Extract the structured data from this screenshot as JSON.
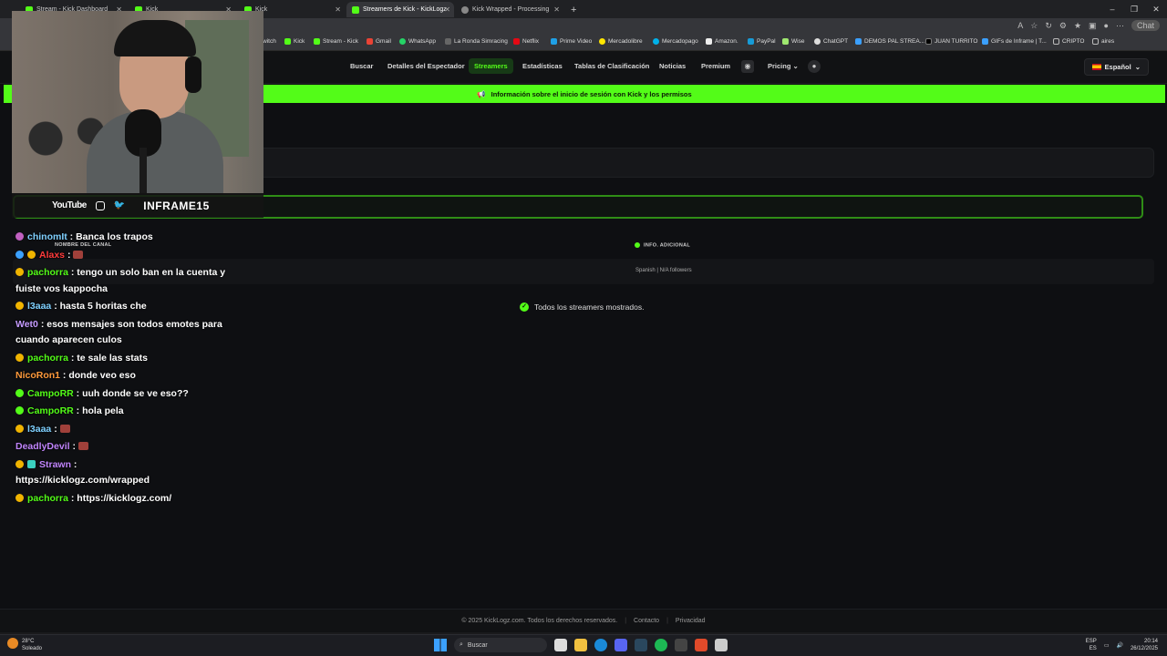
{
  "browser": {
    "tabs": [
      {
        "title": "Stream - Kick Dashboard",
        "active": false
      },
      {
        "title": "Kick",
        "active": false
      },
      {
        "title": "Kick",
        "active": false
      },
      {
        "title": "Streamers de Kick - KickLogz",
        "active": true
      },
      {
        "title": "Kick Wrapped - Processing",
        "active": false
      }
    ],
    "new_tab": "+",
    "chat_button": "Chat",
    "bookmarks": [
      "witch",
      "Kick",
      "Stream - Kick",
      "Gmail",
      "WhatsApp",
      "La Ronda Simracing",
      "Netflix",
      "Prime Video",
      "Mercadolibre",
      "Mercadopago",
      "Amazon.",
      "PayPal",
      "Wise",
      "ChatGPT",
      "DEMOS PAL STREA...",
      "JUAN TURRITO",
      "GIFs de Inframe | T...",
      "CRIPTO",
      "aires"
    ]
  },
  "nav": {
    "items": [
      "Buscar",
      "Detalles del Espectador",
      "Streamers",
      "Estadísticas",
      "Tablas de Clasificación",
      "Noticias",
      "Premium",
      "Pricing"
    ],
    "active": "Streamers",
    "language": "Español"
  },
  "banner": {
    "text": "Información sobre el inicio de sesión con Kick y los permisos"
  },
  "table": {
    "col_channel": "NOMBRE DEL CANAL",
    "col_info": "INFO. ADICIONAL",
    "row_info": "Spanish | N/A followers"
  },
  "status": {
    "all_shown": "Todos los streamers mostrados."
  },
  "footer": {
    "copyright": "© 2025 KickLogz.com. Todos los derechos reservados.",
    "contact": "Contacto",
    "privacy": "Privacidad"
  },
  "webcam": {
    "youtube": "YouTube",
    "channel_name": "INFRAME15"
  },
  "chat": [
    {
      "user": "chinomIt",
      "text": "Banca los trapos",
      "color": "#7fd0ff"
    },
    {
      "user": "Alaxs",
      "text": "",
      "color": "#ff3b3b"
    },
    {
      "user": "pachorra",
      "text": "tengo un solo ban en la cuenta y fuiste vos kappocha",
      "color": "#53fc18"
    },
    {
      "user": "l3aaa",
      "text": "hasta 5 horitas che",
      "color": "#7fd0ff"
    },
    {
      "user": "Wet0",
      "text": "esos mensajes son todos emotes para cuando aparecen culos",
      "color": "#c59bff"
    },
    {
      "user": "pachorra",
      "text": "te sale las stats",
      "color": "#53fc18"
    },
    {
      "user": "NicoRon1",
      "text": "donde veo eso",
      "color": "#ff9a3b"
    },
    {
      "user": "CampoRR",
      "text": "uuh donde se ve eso??",
      "color": "#53fc18"
    },
    {
      "user": "CampoRR",
      "text": "hola pela",
      "color": "#53fc18"
    },
    {
      "user": "l3aaa",
      "text": "",
      "color": "#7fd0ff"
    },
    {
      "user": "DeadlyDevil",
      "text": "",
      "color": "#c084fc"
    },
    {
      "user": "Strawn",
      "text": "https://kicklogz.com/wrapped",
      "color": "#c084fc"
    },
    {
      "user": "pachorra",
      "text": "https://kicklogz.com/",
      "color": "#53fc18"
    }
  ],
  "taskbar": {
    "weather_temp": "28°C",
    "weather_desc": "Soleado",
    "search_placeholder": "Buscar",
    "lang_top": "ESP",
    "lang_bottom": "ES",
    "time": "20:14",
    "date": "26/12/2025"
  }
}
